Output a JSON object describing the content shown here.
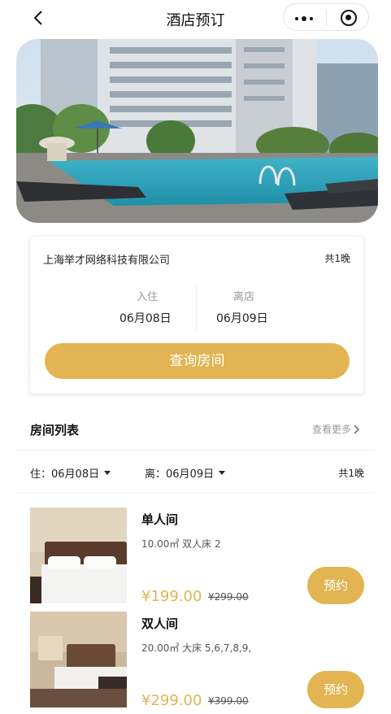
{
  "nav": {
    "title": "酒店预订",
    "back_icon": "chevron-left-icon",
    "more_icon": "more-dots-icon",
    "close_icon": "target-icon"
  },
  "booking": {
    "company": "上海举才网络科技有限公司",
    "nights": "共1晚",
    "checkin_label": "入住",
    "checkin_date": "06月08日",
    "checkout_label": "离店",
    "checkout_date": "06月09日",
    "query_button": "查询房间"
  },
  "room_list": {
    "title": "房间列表",
    "see_more": "查看更多",
    "filter_checkin": "住：06月08日",
    "filter_checkout": "离：06月09日",
    "filter_nights": "共1晚",
    "rooms": [
      {
        "name": "单人间",
        "spec": "10.00㎡  双人床  2",
        "price": "¥199.00",
        "old_price": "¥299.00",
        "button": "预约"
      },
      {
        "name": "双人间",
        "spec": "20.00㎡  大床  5,6,7,8,9,",
        "price": "¥299.00",
        "old_price": "¥399.00",
        "button": "预约"
      }
    ]
  },
  "colors": {
    "accent": "#e2b452",
    "muted": "#999999"
  }
}
